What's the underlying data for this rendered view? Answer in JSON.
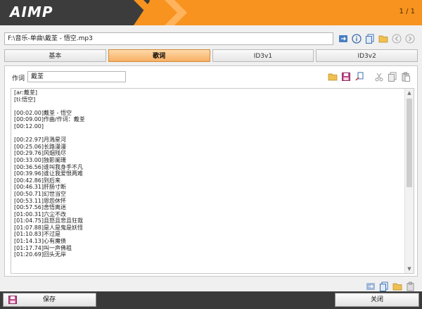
{
  "app": {
    "logo": "AIMP",
    "page_counter": "1 / 1"
  },
  "file": {
    "path": "F:\\音乐-单曲\\戴荃 - 悟空.mp3"
  },
  "tabs": [
    {
      "label": "基本",
      "active": false
    },
    {
      "label": "歌词",
      "active": true
    },
    {
      "label": "ID3v1",
      "active": false
    },
    {
      "label": "ID3v2",
      "active": false
    }
  ],
  "lyrics_panel": {
    "artist_label": "作词",
    "artist_value": "戴荃",
    "lines": [
      "[ar:戴荃]",
      "[ti:悟空]",
      "",
      "[00:02.00]戴荃 - 悟空",
      "[00:09.00]作曲/作词：戴荃",
      "[00:12.00]",
      "",
      "[00:22.97]月溅星河",
      "[00:25.06]长路漫漫",
      "[00:29.76]风烟残尽",
      "[00:33.00]独影阑珊",
      "[00:36.56]谁叫我身手不凡",
      "[00:39.96]谁让我爱恨两难",
      "[00:42.86]到后来",
      "[00:46.31]肝肠寸断",
      "[00:50.71]幻世当空",
      "[00:53.11]恩怨休怀",
      "[00:57.56]舍悟离迷",
      "[01:00.31]六尘不改",
      "[01:04.75]且怒且悲且狂哉",
      "[01:07.88]是人是鬼是妖怪",
      "[01:10.83]不过是",
      "[01:14.13]心有魔债",
      "[01:17.74]叫一声佛祖",
      "[01:20.69]回头无岸"
    ]
  },
  "buttons": {
    "save": "保存",
    "close": "关闭"
  },
  "colors": {
    "accent": "#f7931e",
    "titlebar_dark": "#3c3c3c",
    "bottombar": "#3a3a3a"
  }
}
